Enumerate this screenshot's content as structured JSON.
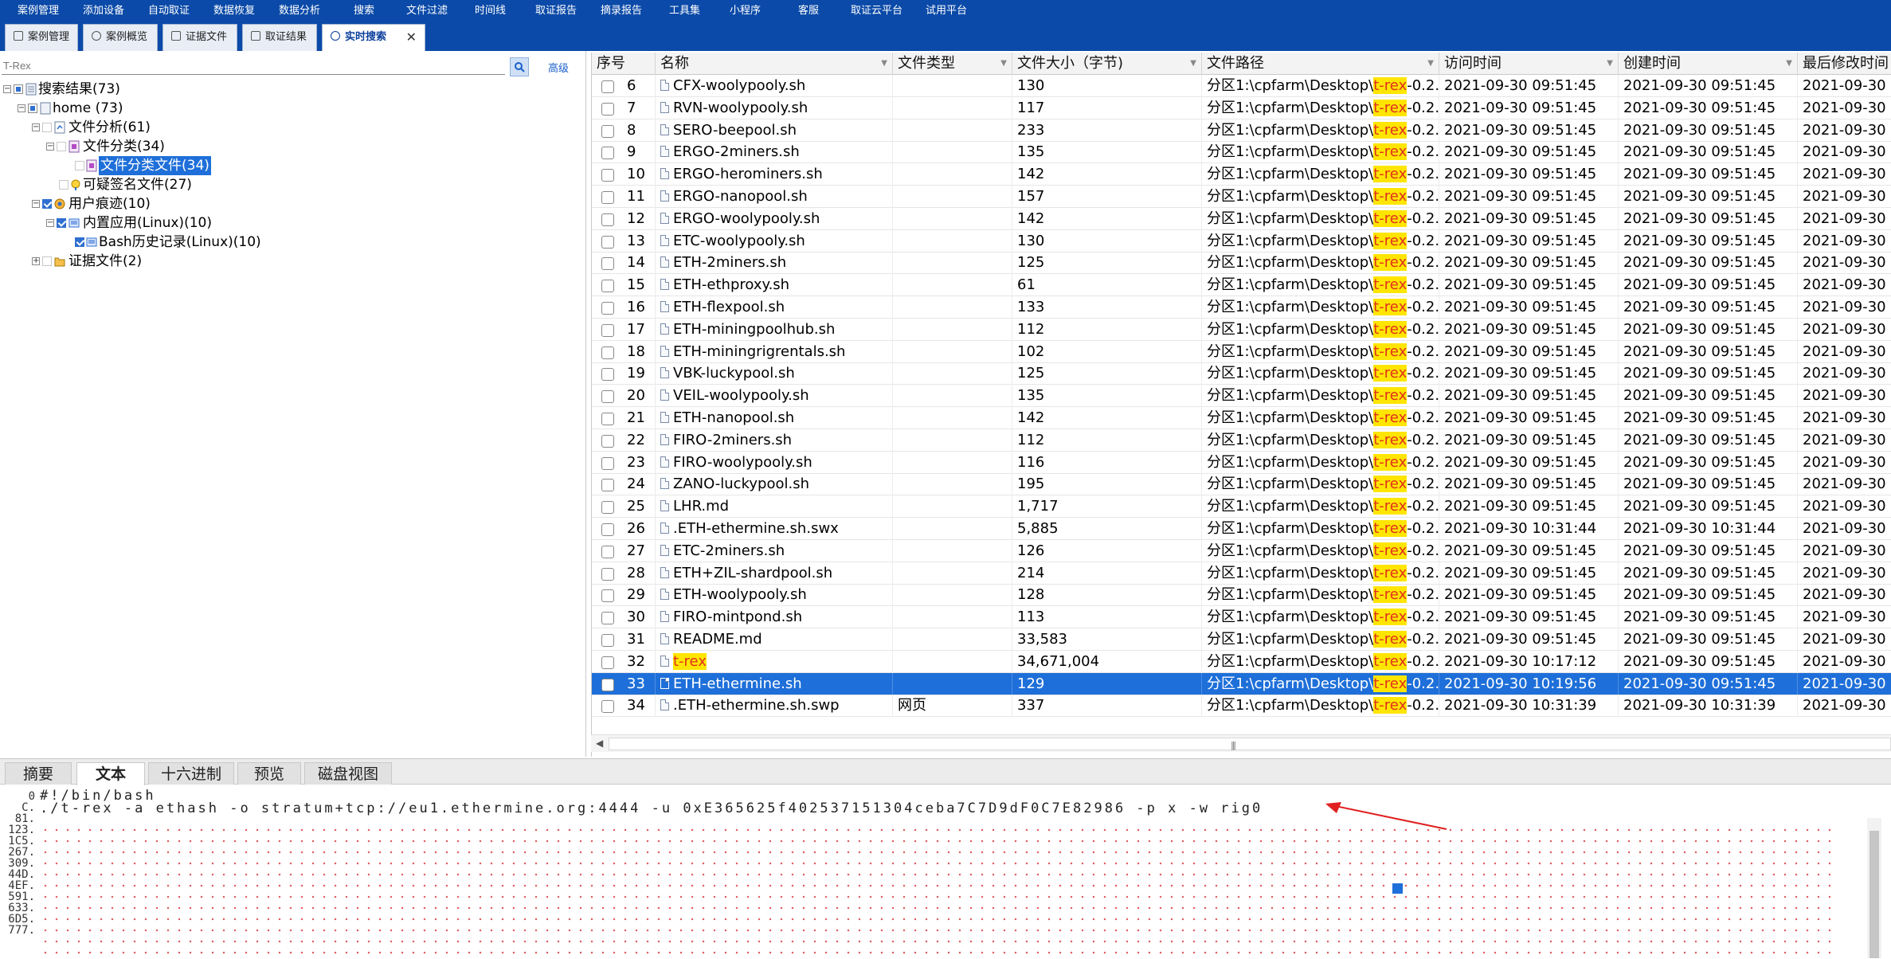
{
  "menubar": {
    "items": [
      "案例管理",
      "添加设备",
      "自动取证",
      "数据恢复",
      "数据分析",
      "搜索",
      "文件过滤",
      "时间线",
      "取证报告",
      "摘录报告",
      "工具集",
      "小程序",
      "客服",
      "取证云平台",
      "试用平台"
    ]
  },
  "tabs": {
    "items": [
      "案例管理",
      "案例概览",
      "证据文件",
      "取证结果",
      "实时搜索"
    ],
    "active": "实时搜索"
  },
  "search": {
    "value": "T-Rex",
    "advanced_label": "高级"
  },
  "tree": {
    "root": "搜索结果(73)",
    "home": "home (73)",
    "file_analysis": "文件分析(61)",
    "file_category": "文件分类(34)",
    "file_category_files": "文件分类文件(34)",
    "suspicious_sig": "可疑签名文件(27)",
    "user_traces": "用户痕迹(10)",
    "builtin_apps": "内置应用(Linux)(10)",
    "bash_history": "Bash历史记录(Linux)(10)",
    "evidence_files": "证据文件(2)"
  },
  "grid": {
    "columns": [
      "序号",
      "名称",
      "文件类型",
      "文件大小（字节)",
      "文件路径",
      "访问时间",
      "创建时间",
      "最后修改时间"
    ],
    "path_prefix": "分区1:\\cpfarm\\Desktop\\",
    "path_highlight": "t-rex",
    "path_suffix": "-0.2...",
    "rows": [
      {
        "no": "6",
        "name": "CFX-woolypooly.sh",
        "type": "",
        "size": "130",
        "access": "2021-09-30 09:51:45",
        "created": "2021-09-30 09:51:45",
        "modified": "2021-09-30"
      },
      {
        "no": "7",
        "name": "RVN-woolypooly.sh",
        "type": "",
        "size": "117",
        "access": "2021-09-30 09:51:45",
        "created": "2021-09-30 09:51:45",
        "modified": "2021-09-30"
      },
      {
        "no": "8",
        "name": "SERO-beepool.sh",
        "type": "",
        "size": "233",
        "access": "2021-09-30 09:51:45",
        "created": "2021-09-30 09:51:45",
        "modified": "2021-09-30"
      },
      {
        "no": "9",
        "name": "ERGO-2miners.sh",
        "type": "",
        "size": "135",
        "access": "2021-09-30 09:51:45",
        "created": "2021-09-30 09:51:45",
        "modified": "2021-09-30"
      },
      {
        "no": "10",
        "name": "ERGO-herominers.sh",
        "type": "",
        "size": "142",
        "access": "2021-09-30 09:51:45",
        "created": "2021-09-30 09:51:45",
        "modified": "2021-09-30"
      },
      {
        "no": "11",
        "name": "ERGO-nanopool.sh",
        "type": "",
        "size": "157",
        "access": "2021-09-30 09:51:45",
        "created": "2021-09-30 09:51:45",
        "modified": "2021-09-30"
      },
      {
        "no": "12",
        "name": "ERGO-woolypooly.sh",
        "type": "",
        "size": "142",
        "access": "2021-09-30 09:51:45",
        "created": "2021-09-30 09:51:45",
        "modified": "2021-09-30"
      },
      {
        "no": "13",
        "name": "ETC-woolypooly.sh",
        "type": "",
        "size": "130",
        "access": "2021-09-30 09:51:45",
        "created": "2021-09-30 09:51:45",
        "modified": "2021-09-30"
      },
      {
        "no": "14",
        "name": "ETH-2miners.sh",
        "type": "",
        "size": "125",
        "access": "2021-09-30 09:51:45",
        "created": "2021-09-30 09:51:45",
        "modified": "2021-09-30"
      },
      {
        "no": "15",
        "name": "ETH-ethproxy.sh",
        "type": "",
        "size": "61",
        "access": "2021-09-30 09:51:45",
        "created": "2021-09-30 09:51:45",
        "modified": "2021-09-30"
      },
      {
        "no": "16",
        "name": "ETH-flexpool.sh",
        "type": "",
        "size": "133",
        "access": "2021-09-30 09:51:45",
        "created": "2021-09-30 09:51:45",
        "modified": "2021-09-30"
      },
      {
        "no": "17",
        "name": "ETH-miningpoolhub.sh",
        "type": "",
        "size": "112",
        "access": "2021-09-30 09:51:45",
        "created": "2021-09-30 09:51:45",
        "modified": "2021-09-30"
      },
      {
        "no": "18",
        "name": "ETH-miningrigrentals.sh",
        "type": "",
        "size": "102",
        "access": "2021-09-30 09:51:45",
        "created": "2021-09-30 09:51:45",
        "modified": "2021-09-30"
      },
      {
        "no": "19",
        "name": "VBK-luckypool.sh",
        "type": "",
        "size": "125",
        "access": "2021-09-30 09:51:45",
        "created": "2021-09-30 09:51:45",
        "modified": "2021-09-30"
      },
      {
        "no": "20",
        "name": "VEIL-woolypooly.sh",
        "type": "",
        "size": "135",
        "access": "2021-09-30 09:51:45",
        "created": "2021-09-30 09:51:45",
        "modified": "2021-09-30"
      },
      {
        "no": "21",
        "name": "ETH-nanopool.sh",
        "type": "",
        "size": "142",
        "access": "2021-09-30 09:51:45",
        "created": "2021-09-30 09:51:45",
        "modified": "2021-09-30"
      },
      {
        "no": "22",
        "name": "FIRO-2miners.sh",
        "type": "",
        "size": "112",
        "access": "2021-09-30 09:51:45",
        "created": "2021-09-30 09:51:45",
        "modified": "2021-09-30"
      },
      {
        "no": "23",
        "name": "FIRO-woolypooly.sh",
        "type": "",
        "size": "116",
        "access": "2021-09-30 09:51:45",
        "created": "2021-09-30 09:51:45",
        "modified": "2021-09-30"
      },
      {
        "no": "24",
        "name": "ZANO-luckypool.sh",
        "type": "",
        "size": "195",
        "access": "2021-09-30 09:51:45",
        "created": "2021-09-30 09:51:45",
        "modified": "2021-09-30"
      },
      {
        "no": "25",
        "name": "LHR.md",
        "type": "",
        "size": "1,717",
        "access": "2021-09-30 09:51:45",
        "created": "2021-09-30 09:51:45",
        "modified": "2021-09-30"
      },
      {
        "no": "26",
        "name": ".ETH-ethermine.sh.swx",
        "type": "",
        "size": "5,885",
        "access": "2021-09-30 10:31:44",
        "created": "2021-09-30 10:31:44",
        "modified": "2021-09-30"
      },
      {
        "no": "27",
        "name": "ETC-2miners.sh",
        "type": "",
        "size": "126",
        "access": "2021-09-30 09:51:45",
        "created": "2021-09-30 09:51:45",
        "modified": "2021-09-30"
      },
      {
        "no": "28",
        "name": "ETH+ZIL-shardpool.sh",
        "type": "",
        "size": "214",
        "access": "2021-09-30 09:51:45",
        "created": "2021-09-30 09:51:45",
        "modified": "2021-09-30"
      },
      {
        "no": "29",
        "name": "ETH-woolypooly.sh",
        "type": "",
        "size": "128",
        "access": "2021-09-30 09:51:45",
        "created": "2021-09-30 09:51:45",
        "modified": "2021-09-30"
      },
      {
        "no": "30",
        "name": "FIRO-mintpond.sh",
        "type": "",
        "size": "113",
        "access": "2021-09-30 09:51:45",
        "created": "2021-09-30 09:51:45",
        "modified": "2021-09-30"
      },
      {
        "no": "31",
        "name": "README.md",
        "type": "",
        "size": "33,583",
        "access": "2021-09-30 09:51:45",
        "created": "2021-09-30 09:51:45",
        "modified": "2021-09-30"
      },
      {
        "no": "32",
        "name": "t-rex",
        "type": "",
        "size": "34,671,004",
        "access": "2021-09-30 10:17:12",
        "created": "2021-09-30 09:51:45",
        "modified": "2021-09-30",
        "name_highlight": true
      },
      {
        "no": "33",
        "name": "ETH-ethermine.sh",
        "type": "",
        "size": "129",
        "access": "2021-09-30 10:19:56",
        "created": "2021-09-30 09:51:45",
        "modified": "2021-09-30",
        "selected": true
      },
      {
        "no": "34",
        "name": ".ETH-ethermine.sh.swp",
        "type": "网页",
        "size": "337",
        "access": "2021-09-30 10:31:39",
        "created": "2021-09-30 10:31:39",
        "modified": "2021-09-30"
      }
    ]
  },
  "bottom": {
    "tabs": [
      "摘要",
      "文本",
      "十六进制",
      "预览",
      "磁盘视图"
    ],
    "active_tab": "文本",
    "line_numbers": [
      "0",
      "C.",
      "81.",
      "123.",
      "1C5.",
      "267.",
      "309.",
      "44D.",
      "4EF.",
      "591.",
      "633.",
      "6D5.",
      "777."
    ],
    "line1": "#!/bin/bash",
    "line2": "./t-rex -a ethash -o stratum+tcp://eu1.ethermine.org:4444 -u 0xE365625f402537151304ceba7C7D9dF0C7E82986 -p x -w rig0"
  },
  "colors": {
    "menubar": "#0b4aa8",
    "selection": "#1e6fd9",
    "highlight_bg": "#ffe500",
    "highlight_fg": "#e0301e",
    "annotation_arrow": "#e02020"
  },
  "icons": [
    "search-icon",
    "file-icon",
    "folder-icon",
    "close-icon",
    "arrow-annotation"
  ]
}
